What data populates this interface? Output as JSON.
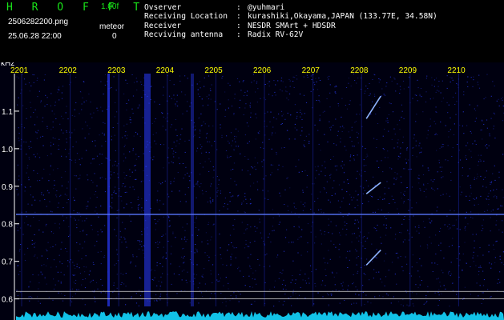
{
  "header": {
    "app_title": "H R O F F T",
    "version": "1.00f",
    "filename": "2506282200.png",
    "datetime": "25.06.28 22:00",
    "meteor_label": "meteor",
    "meteor_count": "0"
  },
  "station_info": [
    {
      "key": "Ovserver",
      "value": "@yuhmari"
    },
    {
      "key": "Receiving Location",
      "value": "kurashiki,Okayama,JAPAN (133.77E, 34.58N)"
    },
    {
      "key": "Receiver",
      "value": "NESDR SMArt + HDSDR"
    },
    {
      "key": "Recviving antenna",
      "value": "Radix RV-62V"
    }
  ],
  "colors": {
    "title_green": "#19e319",
    "minute_label_yellow": "#ffff00",
    "axis_white": "#ffffff",
    "noise_blue": "#2a3cff",
    "spectrum_cyan": "#14d7ff"
  },
  "chart_data": {
    "type": "heatmap",
    "y_unit_label": "kHz",
    "y_range": [
      0.58,
      1.2
    ],
    "y_ticks": [
      1.1,
      1.0,
      0.9,
      0.8,
      0.7,
      0.6
    ],
    "x_minute_labels": [
      "2201",
      "2202",
      "2203",
      "2204",
      "2205",
      "2206",
      "2207",
      "2208",
      "2209",
      "2210"
    ],
    "carrier_frequency_khz": 0.825,
    "meteor_echoes": [
      {
        "minute": "2208",
        "freq_range_khz": [
          1.08,
          1.14
        ]
      },
      {
        "minute": "2208",
        "freq_range_khz": [
          0.88,
          0.91
        ]
      },
      {
        "minute": "2208",
        "freq_range_khz": [
          0.69,
          0.73
        ]
      }
    ],
    "reference_lines_khz": [
      0.62,
      0.6
    ]
  }
}
